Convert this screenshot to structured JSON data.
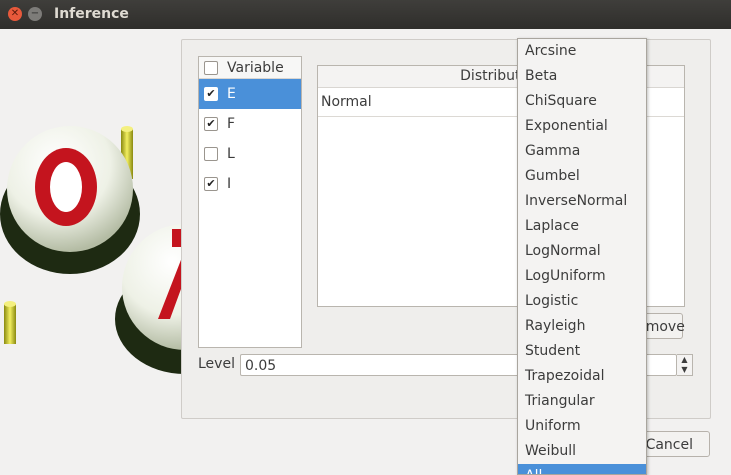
{
  "window": {
    "title": "Inference"
  },
  "variables": {
    "header": "Variable",
    "items": [
      {
        "label": "E",
        "checked": true,
        "selected": true
      },
      {
        "label": "F",
        "checked": true,
        "selected": false
      },
      {
        "label": "L",
        "checked": false,
        "selected": false
      },
      {
        "label": "I",
        "checked": true,
        "selected": false
      }
    ]
  },
  "distribution_table": {
    "header": "Distribution",
    "rows": [
      "Normal"
    ]
  },
  "remove_button": "Remove",
  "level": {
    "label": "Level",
    "value": "0.05"
  },
  "cancel_button": "Cancel",
  "dropdown": {
    "options": [
      "Arcsine",
      "Beta",
      "ChiSquare",
      "Exponential",
      "Gamma",
      "Gumbel",
      "InverseNormal",
      "Laplace",
      "LogNormal",
      "LogUniform",
      "Logistic",
      "Rayleigh",
      "Student",
      "Trapezoidal",
      "Triangular",
      "Uniform",
      "Weibull",
      "All"
    ],
    "highlighted": "All"
  },
  "colors": {
    "selection": "#4a90d9",
    "titlebar": "#3f3e3b",
    "close_button": "#e8593b"
  }
}
